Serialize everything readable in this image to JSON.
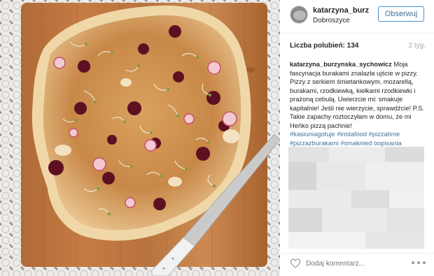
{
  "post": {
    "photo": {
      "alt": "",
      "icon": "pizza-photo"
    },
    "header": {
      "username": "katarzyna_burz...",
      "location": "Dobroszyce",
      "follow_label": "Obserwuj"
    },
    "likes_text": "Liczba polubień: 134",
    "time_ago": "2 tyg.",
    "caption": {
      "username": "katarzyna_burzynska_sychowicz",
      "text": "Moja fascynacja burakami znalazła ujście w pizzy. Pizzy z serkiem śmietankowym, mozarellą, burakami, rzodkiewką, kiełkami rzodkiewki i prażoną cebulą. Uwierzcie mi: smakuje kapitalnie! Jeśli nie wierzycie, sprawdźcie! P.S. Takie zapachy roztoczyłam w domu, że mi Heńko pizzą pachnie!",
      "hashtags": "#kasiuniagotuje #instafood #pizzatime #pizzazburakami #smaknied oopisania"
    },
    "comment_placeholder": "Dodaj komentarz...",
    "icons": {
      "like": "heart-icon",
      "more": "more-options-icon"
    },
    "colors": {
      "link": "#3f729b",
      "follow_border": "#4e8fd4",
      "muted": "#a5a7aa"
    }
  }
}
